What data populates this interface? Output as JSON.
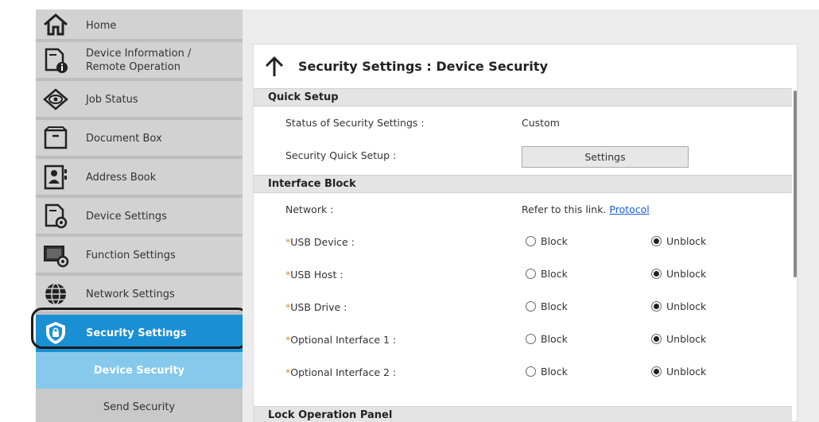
{
  "sidebar": {
    "items": [
      {
        "label": "Home",
        "icon": "home-icon"
      },
      {
        "label": "Device Information /\nRemote Operation",
        "icon": "device-info-icon"
      },
      {
        "label": "Job Status",
        "icon": "eye-icon"
      },
      {
        "label": "Document Box",
        "icon": "document-box-icon"
      },
      {
        "label": "Address Book",
        "icon": "address-book-icon"
      },
      {
        "label": "Device Settings",
        "icon": "device-settings-icon"
      },
      {
        "label": "Function Settings",
        "icon": "function-settings-icon"
      },
      {
        "label": "Network Settings",
        "icon": "globe-icon"
      },
      {
        "label": "Security Settings",
        "icon": "shield-lock-icon"
      }
    ],
    "sub_items": [
      {
        "label": "Device Security"
      },
      {
        "label": "Send Security"
      }
    ]
  },
  "page": {
    "title": "Security Settings : Device Security"
  },
  "sections": {
    "quick_setup": {
      "heading": "Quick Setup",
      "status_label": "Status of Security Settings :",
      "status_value": "Custom",
      "quick_setup_label": "Security Quick Setup :",
      "settings_button": "Settings"
    },
    "interface_block": {
      "heading": "Interface Block",
      "network_label": "Network :",
      "network_text": "Refer to this link.",
      "network_link": "Protocol",
      "block_label": "Block",
      "unblock_label": "Unblock",
      "asterisk": "*",
      "rows": [
        {
          "label": "USB Device :",
          "selected": "unblock"
        },
        {
          "label": "USB Host :",
          "selected": "unblock"
        },
        {
          "label": "USB Drive :",
          "selected": "unblock"
        },
        {
          "label": "Optional Interface 1 :",
          "selected": "unblock"
        },
        {
          "label": "Optional Interface 2 :",
          "selected": "unblock"
        }
      ]
    },
    "lock_panel": {
      "heading": "Lock Operation Panel"
    }
  },
  "colors": {
    "active_nav": "#1a8fd3",
    "current_sub": "#86c9ec",
    "link": "#1a5fd0",
    "asterisk": "#e08a2e"
  }
}
